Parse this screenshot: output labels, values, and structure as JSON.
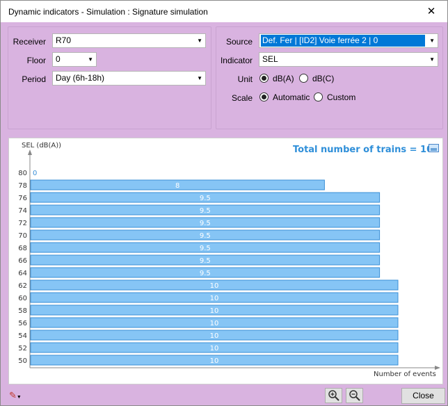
{
  "window": {
    "title": "Dynamic indicators - Simulation : Signature simulation",
    "close_glyph": "✕"
  },
  "left_panel": {
    "receiver_label": "Receiver",
    "receiver_value": "R70",
    "floor_label": "Floor",
    "floor_value": "0",
    "period_label": "Period",
    "period_value": "Day (6h-18h)"
  },
  "right_panel": {
    "source_label": "Source",
    "source_value": "Def. Fer | [ID2] Voie ferrée 2 | 0",
    "indicator_label": "Indicator",
    "indicator_value": "SEL",
    "unit_label": "Unit",
    "unit_options": [
      "dB(A)",
      "dB(C)"
    ],
    "unit_selected": "dB(A)",
    "scale_label": "Scale",
    "scale_options": [
      "Automatic",
      "Custom"
    ],
    "scale_selected": "Automatic"
  },
  "footer": {
    "close_label": "Close",
    "zoom_in_icon": "zoom-in-icon",
    "zoom_out_icon": "zoom-out-icon",
    "edit_menu_icon": "edit-icon"
  },
  "colors": {
    "bar_fill": "#86c5f5",
    "bar_stroke": "#3a8fd6",
    "title_blue": "#2f8fd9",
    "window_bg": "#d9b3e0"
  },
  "chart_data": {
    "type": "bar",
    "orientation": "horizontal",
    "title": "Total number of trains = 10",
    "ylabel": "SEL (dB(A))",
    "xlabel": "Number of events",
    "categories": [
      "80",
      "78",
      "76",
      "74",
      "72",
      "70",
      "68",
      "66",
      "64",
      "62",
      "60",
      "58",
      "56",
      "54",
      "52",
      "50"
    ],
    "values": [
      0,
      8,
      9.5,
      9.5,
      9.5,
      9.5,
      9.5,
      9.5,
      9.5,
      10,
      10,
      10,
      10,
      10,
      10,
      10
    ],
    "value_labels": [
      "0",
      "8",
      "9.5",
      "9.5",
      "9.5",
      "9.5",
      "9.5",
      "9.5",
      "9.5",
      "10",
      "10",
      "10",
      "10",
      "10",
      "10",
      "10"
    ],
    "xlim": [
      0,
      10
    ]
  }
}
